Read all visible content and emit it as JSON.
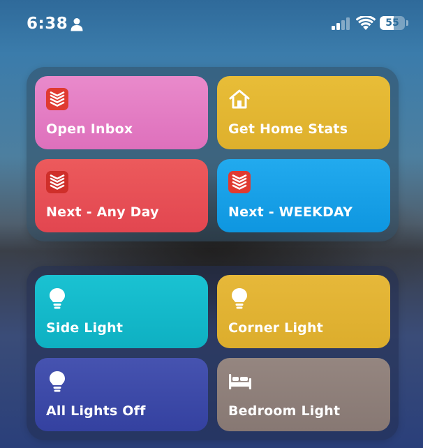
{
  "status_bar": {
    "time": "6:38",
    "battery_level": "55",
    "icons": [
      "person-icon",
      "cellular-signal-icon",
      "wifi-icon",
      "battery-icon"
    ]
  },
  "widget_groups": [
    {
      "tiles": [
        {
          "label": "Open Inbox",
          "icon": "todoist-icon",
          "color": "#e07bc2"
        },
        {
          "label": "Get Home Stats",
          "icon": "home-icon",
          "color": "#e3b52f"
        },
        {
          "label": "Next - Any Day",
          "icon": "todoist-icon",
          "color": "#e84d52"
        },
        {
          "label": "Next - WEEKDAY",
          "icon": "todoist-icon",
          "color": "#16a0e6"
        }
      ]
    },
    {
      "tiles": [
        {
          "label": "Side Light",
          "icon": "lightbulb-icon",
          "color": "#12b8c8"
        },
        {
          "label": "Corner Light",
          "icon": "lightbulb-icon",
          "color": "#e0b232"
        },
        {
          "label": "All Lights Off",
          "icon": "lightbulb-icon",
          "color": "#3c4aa8"
        },
        {
          "label": "Bedroom Light",
          "icon": "bed-icon",
          "color": "#8e7f79"
        }
      ]
    }
  ]
}
